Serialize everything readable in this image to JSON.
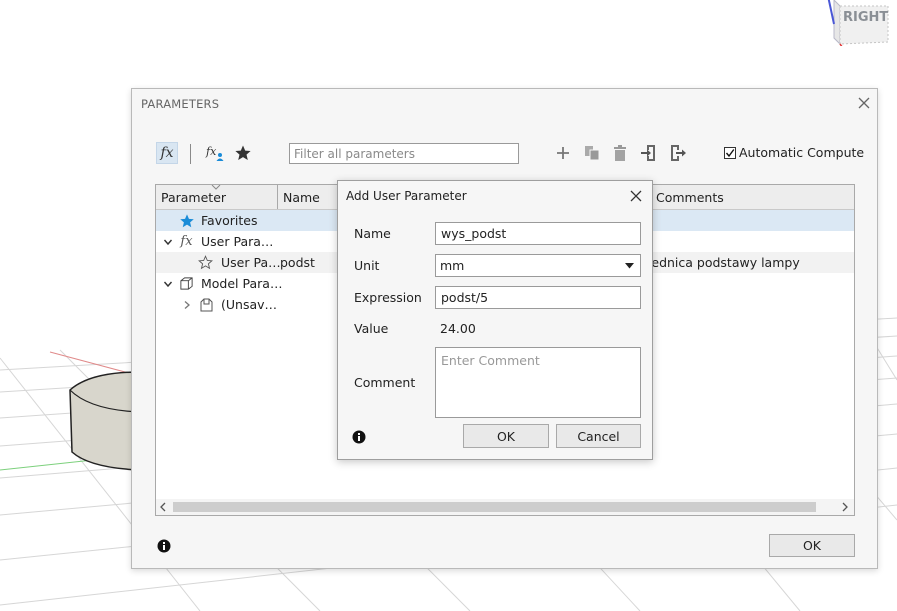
{
  "viewcube": {
    "label": "RIGHT"
  },
  "parameters_dialog": {
    "title": "PARAMETERS",
    "filter_placeholder": "Filter all parameters",
    "auto_compute_label": "Automatic Compute",
    "auto_compute_checked": true,
    "columns": {
      "parameter": "Parameter",
      "name": "Name",
      "comments": "Comments"
    },
    "rows": {
      "favorites": "Favorites",
      "user_params": "User Para…",
      "user_param_item": {
        "parameter": "User Pa…",
        "name": "podst",
        "comment": "średnica podstawy lampy"
      },
      "model_params": "Model Para…",
      "unsaved": "(Unsav…"
    },
    "ok_label": "OK"
  },
  "add_user_parameter": {
    "title": "Add User Parameter",
    "name_label": "Name",
    "name_value": "wys_podst",
    "unit_label": "Unit",
    "unit_value": "mm",
    "expression_label": "Expression",
    "expression_value": "podst/5",
    "value_label": "Value",
    "value_value": "24.00",
    "comment_label": "Comment",
    "comment_placeholder": "Enter Comment",
    "ok_label": "OK",
    "cancel_label": "Cancel"
  },
  "colors": {
    "accent_blue": "#1a8cd8",
    "selected_row": "#dbe8f4",
    "shape_body": "#d8d6cc"
  }
}
